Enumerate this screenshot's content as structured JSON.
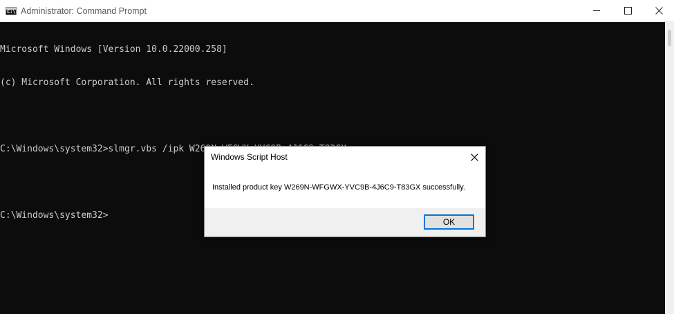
{
  "window": {
    "title": "Administrator: Command Prompt"
  },
  "console": {
    "lines": [
      "Microsoft Windows [Version 10.0.22000.258]",
      "(c) Microsoft Corporation. All rights reserved.",
      "",
      "C:\\Windows\\system32>slmgr.vbs /ipk W269N-WFGWX-YVC9B-4J6C9-T83GX",
      "",
      "C:\\Windows\\system32>"
    ]
  },
  "dialog": {
    "title": "Windows Script Host",
    "message": "Installed product key W269N-WFGWX-YVC9B-4J6C9-T83GX successfully.",
    "ok_label": "OK"
  },
  "colors": {
    "console_background": "#0c0c0c",
    "console_text": "#cccccc",
    "button_focus_border": "#0078d7"
  },
  "icons": {
    "app": "command-prompt-icon",
    "minimize": "minimize-icon",
    "maximize": "maximize-icon",
    "close": "close-icon"
  }
}
